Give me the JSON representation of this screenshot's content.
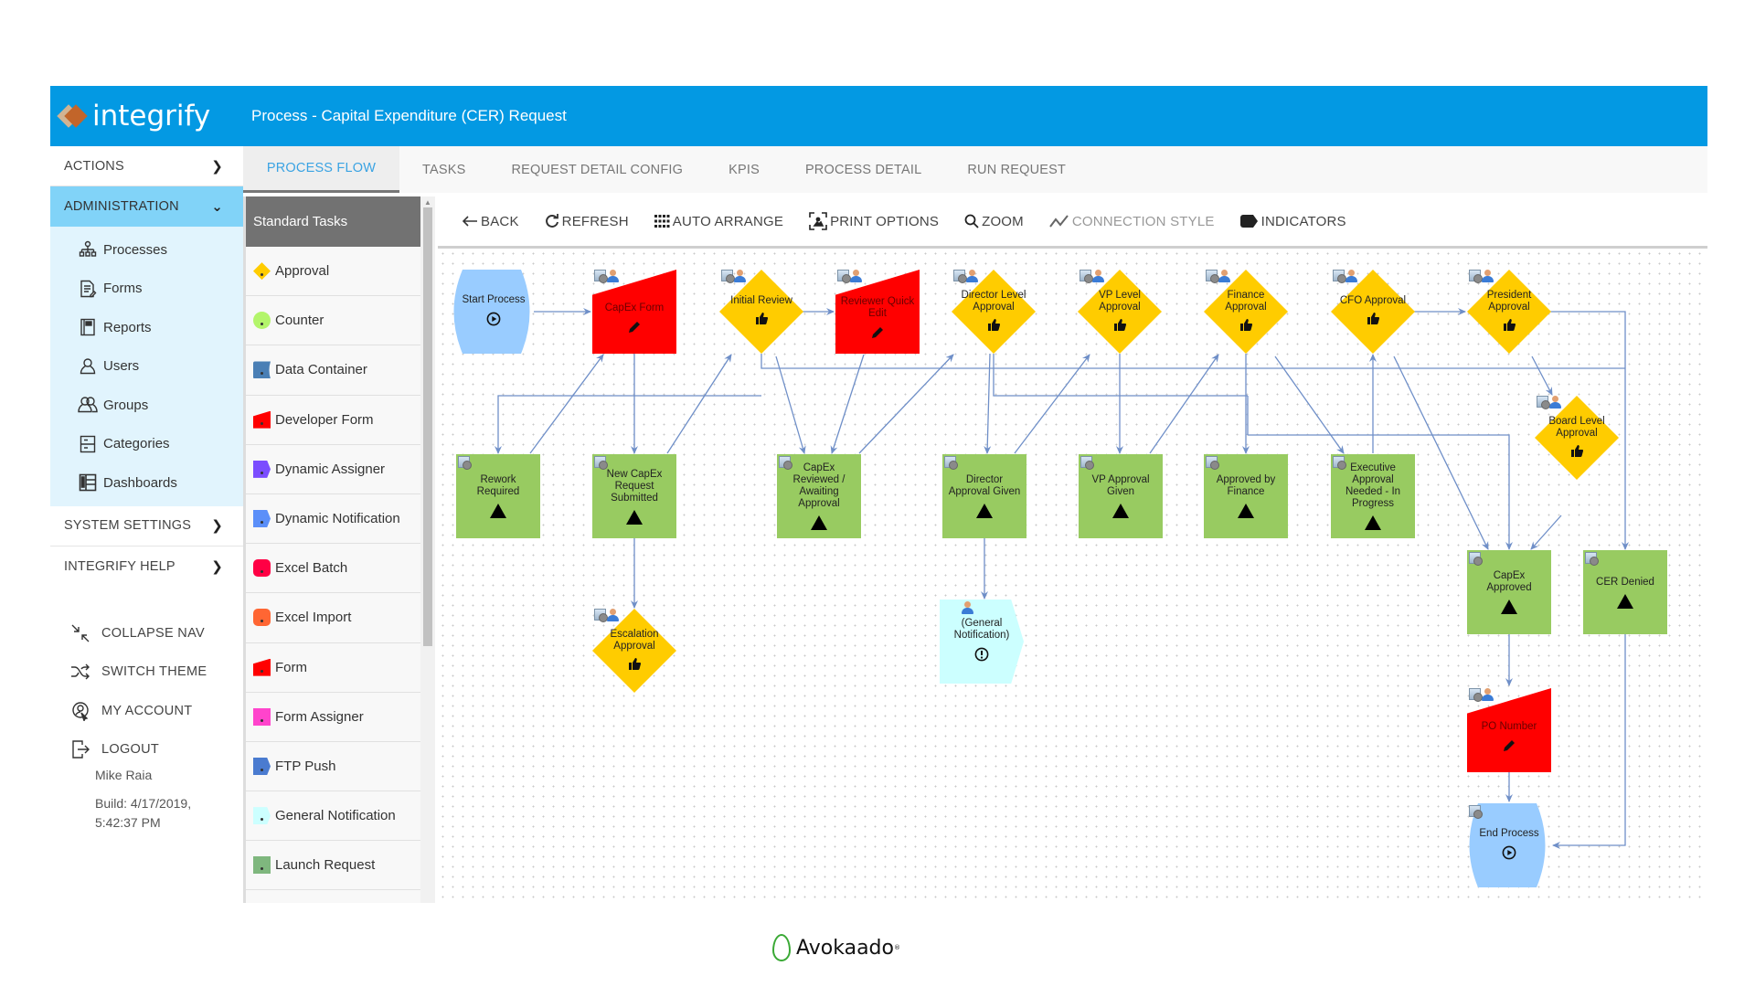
{
  "brand": {
    "name": "integrify"
  },
  "header": {
    "title": "Process - Capital Expenditure (CER) Request"
  },
  "sidebar": {
    "actions": "ACTIONS",
    "administration": "ADMINISTRATION",
    "admin_items": [
      {
        "label": "Processes",
        "icon": "hierarchy-icon"
      },
      {
        "label": "Forms",
        "icon": "form-icon"
      },
      {
        "label": "Reports",
        "icon": "report-icon"
      },
      {
        "label": "Users",
        "icon": "user-icon"
      },
      {
        "label": "Groups",
        "icon": "groups-icon"
      },
      {
        "label": "Categories",
        "icon": "categories-icon"
      },
      {
        "label": "Dashboards",
        "icon": "dashboard-icon"
      }
    ],
    "system_settings": "SYSTEM SETTINGS",
    "integrify_help": "INTEGRIFY HELP",
    "collapse_nav": "COLLAPSE NAV",
    "switch_theme": "SWITCH THEME",
    "my_account": "MY ACCOUNT",
    "logout": "LOGOUT",
    "user_name": "Mike Raia",
    "build_line1": "Build: 4/17/2019,",
    "build_line2": "5:42:37 PM"
  },
  "tabs": [
    {
      "label": "PROCESS FLOW",
      "active": true
    },
    {
      "label": "TASKS"
    },
    {
      "label": "REQUEST DETAIL CONFIG"
    },
    {
      "label": "KPIS"
    },
    {
      "label": "PROCESS DETAIL"
    },
    {
      "label": "RUN REQUEST"
    }
  ],
  "tasks_panel": {
    "header": "Standard Tasks",
    "items": [
      {
        "label": "Approval",
        "color": "#ffcc00",
        "shape": "diamond"
      },
      {
        "label": "Counter",
        "color": "#b3f56b",
        "shape": "circle"
      },
      {
        "label": "Data Container",
        "color": "#4a7fb5",
        "shape": "container"
      },
      {
        "label": "Developer Form",
        "color": "#ff0000",
        "shape": "form"
      },
      {
        "label": "Dynamic Assigner",
        "color": "#7b4dff",
        "shape": "pentagon"
      },
      {
        "label": "Dynamic Notification",
        "color": "#5b8ff9",
        "shape": "pentagon"
      },
      {
        "label": "Excel Batch",
        "color": "#ff0044",
        "shape": "rounded"
      },
      {
        "label": "Excel Import",
        "color": "#ff6633",
        "shape": "rounded"
      },
      {
        "label": "Form",
        "color": "#ff0000",
        "shape": "form"
      },
      {
        "label": "Form Assigner",
        "color": "#ff44cc",
        "shape": "square"
      },
      {
        "label": "FTP Push",
        "color": "#4a7bd0",
        "shape": "pentagon"
      },
      {
        "label": "General Notification",
        "color": "#ccffff",
        "shape": "pentagon"
      },
      {
        "label": "Launch Request",
        "color": "#7fb77e",
        "shape": "square"
      }
    ]
  },
  "toolbar": {
    "back": "BACK",
    "refresh": "REFRESH",
    "auto_arrange": "AUTO ARRANGE",
    "print_options": "PRINT OPTIONS",
    "zoom": "ZOOM",
    "connection_style": "CONNECTION STYLE",
    "indicators": "INDICATORS"
  },
  "flow": {
    "colors": {
      "approval": "#ffcc00",
      "form": "#ff0000",
      "status": "#98cb61",
      "start_end": "#99ccff",
      "notification": "#ccffff",
      "connector": "#6f8fc8"
    },
    "nodes": {
      "start": "Start Process",
      "capex_form": "CapEx Form",
      "initial_review": "Initial Review",
      "reviewer_quick_edit": "Reviewer Quick Edit",
      "director_level": "Director Level Approval",
      "vp_level": "VP Level Approval",
      "finance_approval": "Finance Approval",
      "cfo_approval": "CFO Approval",
      "president_approval": "President Approval",
      "board_level": "Board Level Approval",
      "rework_required": "Rework Required",
      "new_capex": "New CapEx Request Submitted",
      "capex_reviewed": "CapEx Reviewed / Awaiting Approval",
      "director_given": "Director Approval Given",
      "vp_given": "VP Approval Given",
      "approved_finance": "Approved by Finance",
      "executive_needed": "Executive Approval Needed - In Progress",
      "capex_approved": "CapEx Approved",
      "cer_denied": "CER Denied",
      "escalation": "Escalation Approval",
      "general_notification": "(General Notification)",
      "po_number": "PO Number",
      "end": "End Process"
    }
  },
  "footer": {
    "brand": "Avokaado"
  }
}
